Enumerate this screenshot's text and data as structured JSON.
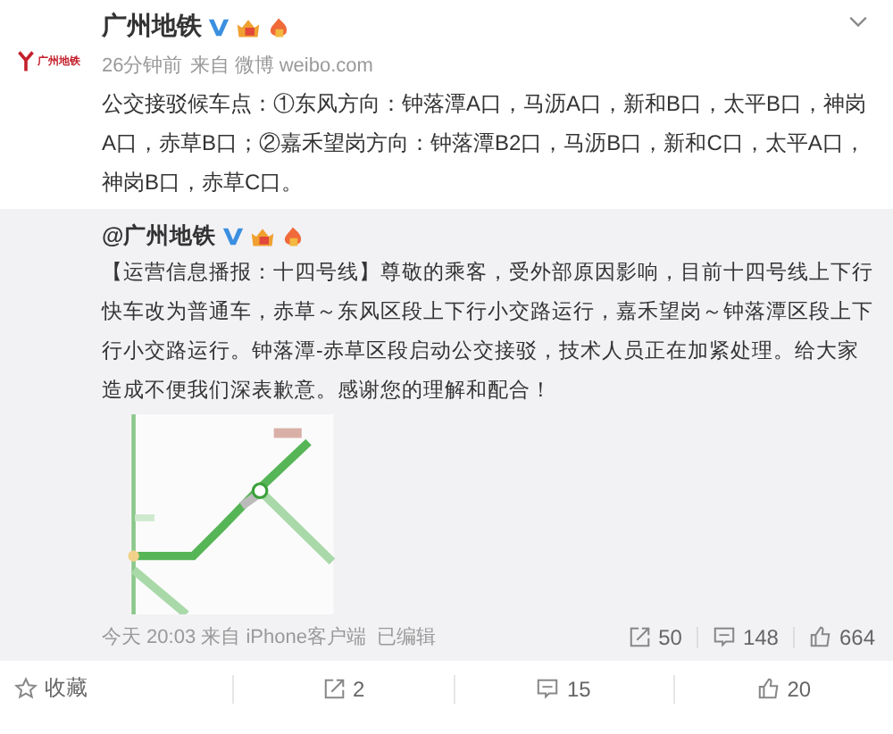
{
  "post": {
    "author": "广州地铁",
    "avatar_text": "广州地铁",
    "time": "26分钟前",
    "source": "来自 微博 weibo.com",
    "text": "公交接驳候车点：①东风方向：钟落潭A口，马沥A口，新和B口，太平B口，神岗A口，赤草B口；②嘉禾望岗方向：钟落潭B2口，马沥B口，新和C口，太平A口，神岗B口，赤草C口。"
  },
  "repost": {
    "author": "@广州地铁",
    "text": "【运营信息播报：十四号线】尊敬的乘客，受外部原因影响，目前十四号线上下行快车改为普通车，赤草～东风区段上下行小交路运行，嘉禾望岗～钟落潭区段上下行小交路运行。钟落潭-赤草区段启动公交接驳，技术人员正在加紧处理。给大家造成不便我们深表歉意。感谢您的理解和配合！",
    "meta": "今天 20:03 来自 iPhone客户端",
    "edited": "已编辑",
    "stats": [
      {
        "kind": "repost",
        "count": "50"
      },
      {
        "kind": "comment",
        "count": "148"
      },
      {
        "kind": "like",
        "count": "664"
      }
    ]
  },
  "actions": [
    {
      "kind": "favorite",
      "label": "收藏"
    },
    {
      "kind": "repost",
      "label": "2"
    },
    {
      "kind": "comment",
      "label": "15"
    },
    {
      "kind": "like",
      "label": "20"
    }
  ]
}
